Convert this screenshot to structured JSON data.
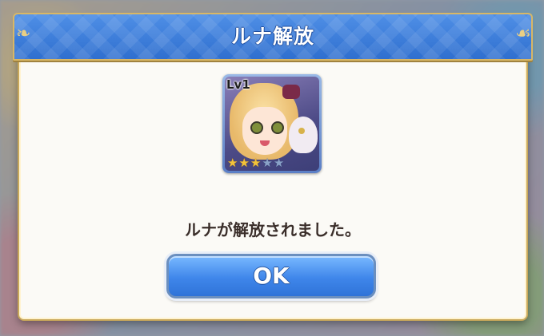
{
  "dialog": {
    "title": "ルナ解放",
    "message": "ルナが解放されました。",
    "ok_label": "OK"
  },
  "character": {
    "level_label": "Lv1",
    "stars_earned": 3,
    "stars_total": 5
  },
  "colors": {
    "header_blue": "#2f6fcf",
    "button_blue": "#3f86ea",
    "frame_gold": "#c9a85a",
    "star_on": "#f3c33a"
  }
}
